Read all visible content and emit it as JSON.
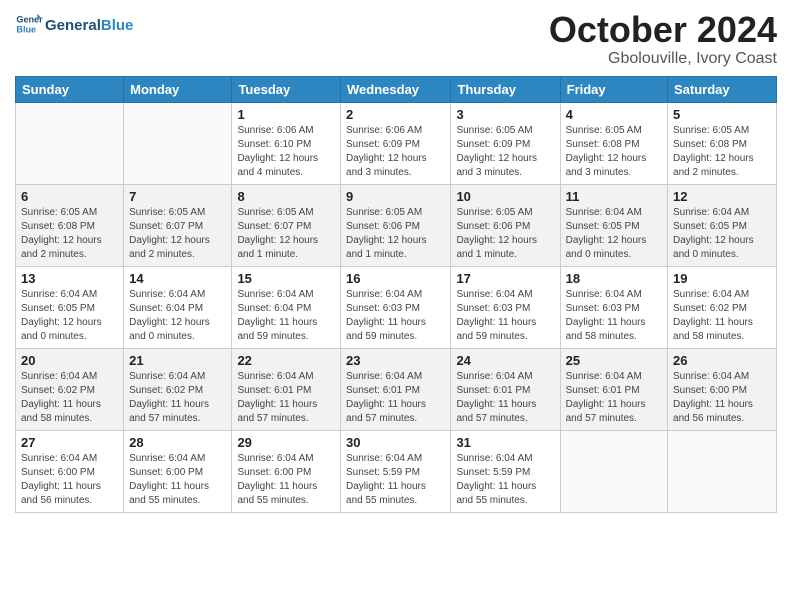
{
  "header": {
    "logo_general": "General",
    "logo_blue": "Blue",
    "month_title": "October 2024",
    "location": "Gbolouville, Ivory Coast"
  },
  "weekdays": [
    "Sunday",
    "Monday",
    "Tuesday",
    "Wednesday",
    "Thursday",
    "Friday",
    "Saturday"
  ],
  "weeks": [
    [
      {
        "day": "",
        "info": ""
      },
      {
        "day": "",
        "info": ""
      },
      {
        "day": "1",
        "info": "Sunrise: 6:06 AM\nSunset: 6:10 PM\nDaylight: 12 hours\nand 4 minutes."
      },
      {
        "day": "2",
        "info": "Sunrise: 6:06 AM\nSunset: 6:09 PM\nDaylight: 12 hours\nand 3 minutes."
      },
      {
        "day": "3",
        "info": "Sunrise: 6:05 AM\nSunset: 6:09 PM\nDaylight: 12 hours\nand 3 minutes."
      },
      {
        "day": "4",
        "info": "Sunrise: 6:05 AM\nSunset: 6:08 PM\nDaylight: 12 hours\nand 3 minutes."
      },
      {
        "day": "5",
        "info": "Sunrise: 6:05 AM\nSunset: 6:08 PM\nDaylight: 12 hours\nand 2 minutes."
      }
    ],
    [
      {
        "day": "6",
        "info": "Sunrise: 6:05 AM\nSunset: 6:08 PM\nDaylight: 12 hours\nand 2 minutes."
      },
      {
        "day": "7",
        "info": "Sunrise: 6:05 AM\nSunset: 6:07 PM\nDaylight: 12 hours\nand 2 minutes."
      },
      {
        "day": "8",
        "info": "Sunrise: 6:05 AM\nSunset: 6:07 PM\nDaylight: 12 hours\nand 1 minute."
      },
      {
        "day": "9",
        "info": "Sunrise: 6:05 AM\nSunset: 6:06 PM\nDaylight: 12 hours\nand 1 minute."
      },
      {
        "day": "10",
        "info": "Sunrise: 6:05 AM\nSunset: 6:06 PM\nDaylight: 12 hours\nand 1 minute."
      },
      {
        "day": "11",
        "info": "Sunrise: 6:04 AM\nSunset: 6:05 PM\nDaylight: 12 hours\nand 0 minutes."
      },
      {
        "day": "12",
        "info": "Sunrise: 6:04 AM\nSunset: 6:05 PM\nDaylight: 12 hours\nand 0 minutes."
      }
    ],
    [
      {
        "day": "13",
        "info": "Sunrise: 6:04 AM\nSunset: 6:05 PM\nDaylight: 12 hours\nand 0 minutes."
      },
      {
        "day": "14",
        "info": "Sunrise: 6:04 AM\nSunset: 6:04 PM\nDaylight: 12 hours\nand 0 minutes."
      },
      {
        "day": "15",
        "info": "Sunrise: 6:04 AM\nSunset: 6:04 PM\nDaylight: 11 hours\nand 59 minutes."
      },
      {
        "day": "16",
        "info": "Sunrise: 6:04 AM\nSunset: 6:03 PM\nDaylight: 11 hours\nand 59 minutes."
      },
      {
        "day": "17",
        "info": "Sunrise: 6:04 AM\nSunset: 6:03 PM\nDaylight: 11 hours\nand 59 minutes."
      },
      {
        "day": "18",
        "info": "Sunrise: 6:04 AM\nSunset: 6:03 PM\nDaylight: 11 hours\nand 58 minutes."
      },
      {
        "day": "19",
        "info": "Sunrise: 6:04 AM\nSunset: 6:02 PM\nDaylight: 11 hours\nand 58 minutes."
      }
    ],
    [
      {
        "day": "20",
        "info": "Sunrise: 6:04 AM\nSunset: 6:02 PM\nDaylight: 11 hours\nand 58 minutes."
      },
      {
        "day": "21",
        "info": "Sunrise: 6:04 AM\nSunset: 6:02 PM\nDaylight: 11 hours\nand 57 minutes."
      },
      {
        "day": "22",
        "info": "Sunrise: 6:04 AM\nSunset: 6:01 PM\nDaylight: 11 hours\nand 57 minutes."
      },
      {
        "day": "23",
        "info": "Sunrise: 6:04 AM\nSunset: 6:01 PM\nDaylight: 11 hours\nand 57 minutes."
      },
      {
        "day": "24",
        "info": "Sunrise: 6:04 AM\nSunset: 6:01 PM\nDaylight: 11 hours\nand 57 minutes."
      },
      {
        "day": "25",
        "info": "Sunrise: 6:04 AM\nSunset: 6:01 PM\nDaylight: 11 hours\nand 57 minutes."
      },
      {
        "day": "26",
        "info": "Sunrise: 6:04 AM\nSunset: 6:00 PM\nDaylight: 11 hours\nand 56 minutes."
      }
    ],
    [
      {
        "day": "27",
        "info": "Sunrise: 6:04 AM\nSunset: 6:00 PM\nDaylight: 11 hours\nand 56 minutes."
      },
      {
        "day": "28",
        "info": "Sunrise: 6:04 AM\nSunset: 6:00 PM\nDaylight: 11 hours\nand 55 minutes."
      },
      {
        "day": "29",
        "info": "Sunrise: 6:04 AM\nSunset: 6:00 PM\nDaylight: 11 hours\nand 55 minutes."
      },
      {
        "day": "30",
        "info": "Sunrise: 6:04 AM\nSunset: 5:59 PM\nDaylight: 11 hours\nand 55 minutes."
      },
      {
        "day": "31",
        "info": "Sunrise: 6:04 AM\nSunset: 5:59 PM\nDaylight: 11 hours\nand 55 minutes."
      },
      {
        "day": "",
        "info": ""
      },
      {
        "day": "",
        "info": ""
      }
    ]
  ]
}
